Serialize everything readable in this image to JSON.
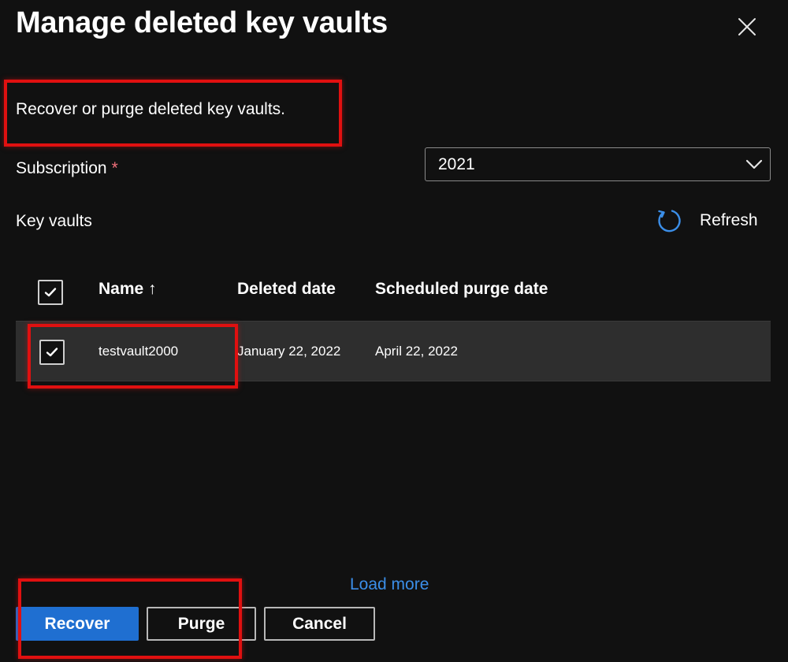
{
  "dialog": {
    "title": "Manage deleted key vaults",
    "description": "Recover or purge deleted key vaults."
  },
  "subscription": {
    "label": "Subscription",
    "required_marker": "*",
    "selected": "2021"
  },
  "key_vaults": {
    "label": "Key vaults",
    "refresh_label": "Refresh"
  },
  "table": {
    "columns": {
      "name": "Name ↑",
      "deleted_date": "Deleted date",
      "purge_date": "Scheduled purge date"
    },
    "rows": [
      {
        "selected": true,
        "name": "testvault2000",
        "deleted_date": "January 22, 2022",
        "purge_date": "April 22, 2022"
      }
    ]
  },
  "load_more": "Load more",
  "actions": {
    "recover": "Recover",
    "purge": "Purge",
    "cancel": "Cancel"
  },
  "icons": {
    "close": "close-icon",
    "chevron": "chevron-down-icon",
    "refresh": "refresh-icon",
    "check": "checkmark-icon"
  },
  "colors": {
    "background": "#111111",
    "primary": "#1f6fd1",
    "link": "#3b8ee8",
    "highlight": "#e01010",
    "required": "#f1707b",
    "row_selected": "#2e2e2e"
  }
}
